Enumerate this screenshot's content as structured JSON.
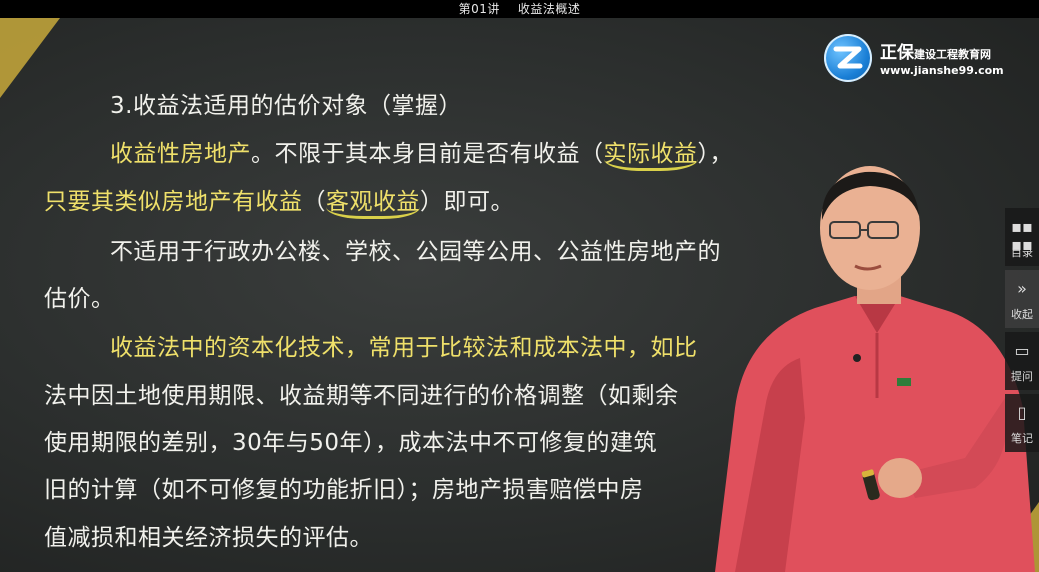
{
  "window": {
    "title_part1": "第01讲",
    "title_part2": "收益法概述"
  },
  "logo": {
    "name": "正保",
    "tagline": "建设工程教育网",
    "url": "www.jianshe99.com"
  },
  "lecture": {
    "heading": "3.收益法适用的估价对象（掌握）",
    "p1_a": "收益性房地产",
    "p1_b": "。不限于其本身目前是否有收益（",
    "p1_c": "实际收益",
    "p1_d": "），",
    "p2_a": "只要其类似房地产有收益",
    "p2_b": "（",
    "p2_c": "客观收益",
    "p2_d": "）",
    "p2_e": "即可。",
    "p3": "不适用于行政办公楼、学校、公园等公用、公益性房地产的",
    "p4": "估价。",
    "p5": "收益法中的资本化技术，常用于比较法和成本法中，如比",
    "p6": "法中因土地使用期限、收益期等不同进行的价格调整（如剩余",
    "p7": "使用期限的差别，30年与50年），成本法中不可修复的建筑",
    "p8": "旧的计算（如不可修复的功能折旧）；房地产损害赔偿中房",
    "p9": "值减损和相关经济损失的评估。"
  },
  "sidebar": {
    "items": [
      {
        "label": "目录",
        "icon": "grid-icon"
      },
      {
        "label": "收起",
        "icon": "double-chevron-right-icon"
      },
      {
        "label": "提问",
        "icon": "chat-bubble-icon"
      },
      {
        "label": "笔记",
        "icon": "note-icon"
      }
    ]
  },
  "colors": {
    "highlight": "#efe06a",
    "board": "#2f3231",
    "shirt": "#e0505c",
    "accent": "#c8a93b"
  }
}
